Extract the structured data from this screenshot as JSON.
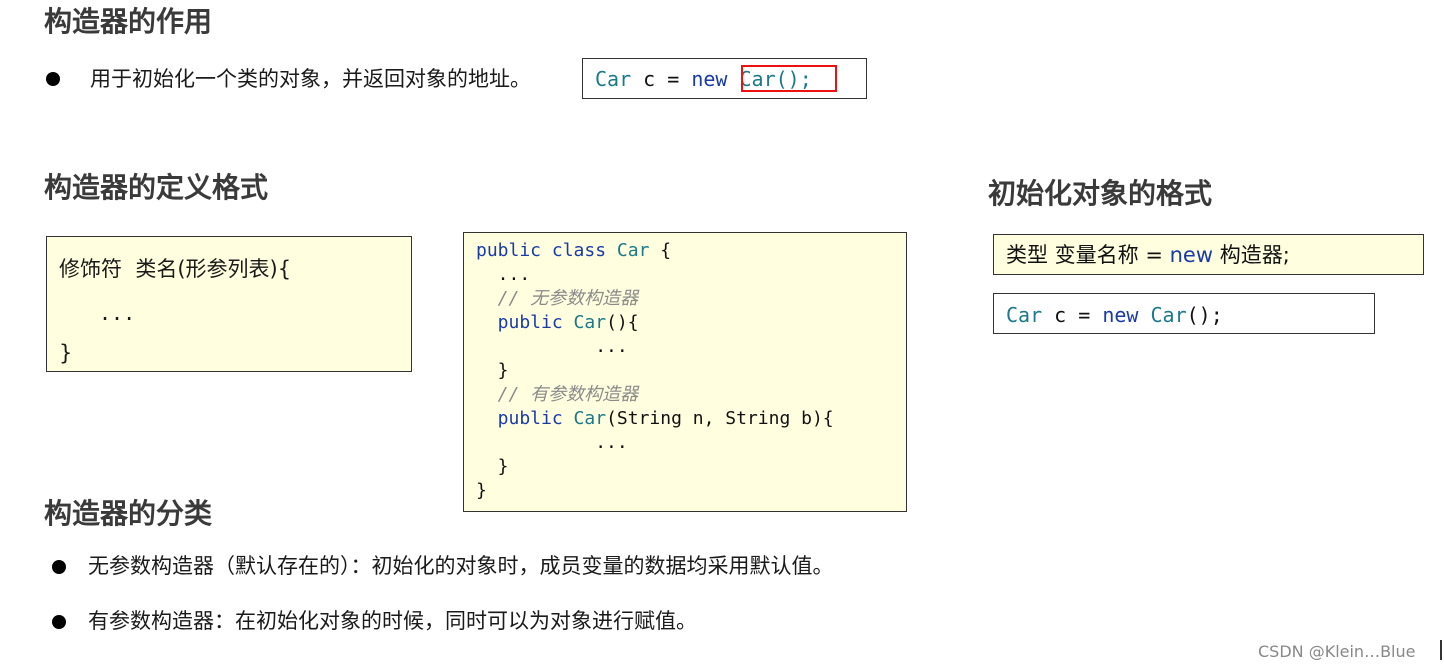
{
  "sections": {
    "purpose": {
      "heading": "构造器的作用",
      "bullet_text": "用于初始化一个类的对象，并返回对象的地址。",
      "code": {
        "type_name": "Car",
        "var_name": " c = ",
        "new_kw": "new",
        "ctor_call": "Car();"
      }
    },
    "definition": {
      "heading": "构造器的定义格式",
      "format_box": {
        "line1": "修饰符  类名(形参列表){",
        "line2": "...",
        "line3": "}"
      },
      "code_box": {
        "lines": [
          {
            "kw": "public class ",
            "cls": "Car",
            "rest": " {"
          },
          {
            "rest": "  ..."
          },
          {
            "cm": "  // 无参数构造器"
          },
          {
            "kw": "  public ",
            "cls": "Car",
            "rest": "(){"
          },
          {
            "rest": "           ..."
          },
          {
            "rest": "  }"
          },
          {
            "cm": "  // 有参数构造器"
          },
          {
            "kw": "  public ",
            "cls": "Car",
            "rest": "(String n, String b){"
          },
          {
            "rest": "           ..."
          },
          {
            "rest": "  }"
          },
          {
            "rest": "}"
          }
        ]
      }
    },
    "init_format": {
      "heading": "初始化对象的格式",
      "box1": {
        "prefix": "类型 变量名称 = ",
        "new_kw": "new",
        "suffix": " 构造器;"
      },
      "box2": {
        "type_name": "Car",
        "var_name": " c = ",
        "new_kw": "new",
        "ctor_call": " Car",
        "end": "();"
      }
    },
    "classification": {
      "heading": "构造器的分类",
      "bullets": [
        "无参数构造器（默认存在的）：初始化的对象时，成员变量的数据均采用默认值。",
        "有参数构造器：在初始化对象的时候，同时可以为对象进行赋值。"
      ]
    }
  },
  "watermark": "CSDN @Klein…Blue",
  "colors": {
    "box_bg": "#ffffe0",
    "keyword": "#1a3ba6",
    "class_name": "#1a7a8a",
    "comment": "#8a8a8a",
    "highlight": "#e11111"
  }
}
